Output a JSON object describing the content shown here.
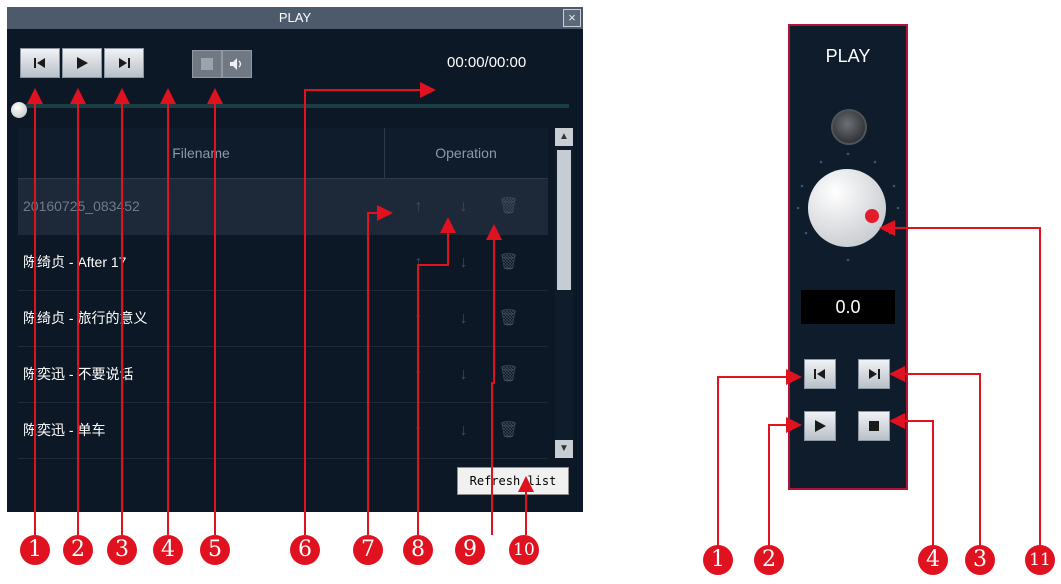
{
  "player": {
    "title": "PLAY",
    "close": "×",
    "time": "00:00/00:00",
    "controls": {
      "prev": "◀",
      "play": "▶",
      "next": "▶"
    },
    "volume_icon": "🔊",
    "columns": [
      "Filename",
      "Operation"
    ],
    "rows": [
      "20160725_083452",
      "陈绮贞 - After 17",
      "陈绮贞 - 旅行的意义",
      "陈奕迅 - 不要说话",
      "陈奕迅 - 单车"
    ],
    "op_icons": [
      "↑",
      "↓",
      "🗑"
    ],
    "refresh": "Refresh list"
  },
  "panel": {
    "title": "PLAY",
    "readout": "0.0"
  },
  "callouts": [
    "1",
    "2",
    "3",
    "4",
    "5",
    "6",
    "7",
    "8",
    "9",
    "10",
    "1",
    "2",
    "4",
    "3",
    "11"
  ],
  "colors": {
    "accent": "#e0121f",
    "window_bg": "#0d1826",
    "panel_border": "#b01536"
  }
}
